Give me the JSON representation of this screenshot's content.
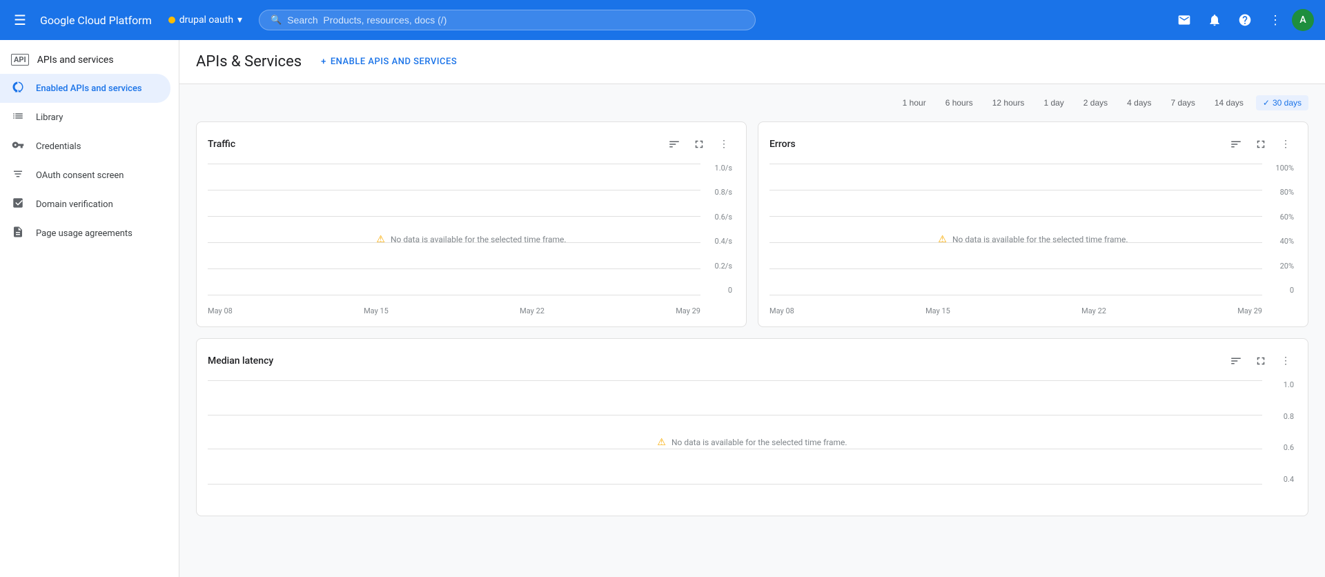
{
  "app": {
    "title": "Google Cloud Platform",
    "api_badge": "API"
  },
  "nav": {
    "menu_icon": "☰",
    "project_name": "drupal oauth",
    "project_dot_color": "#fbbc04",
    "search_placeholder": "Search  Products, resources, docs (/)",
    "search_icon": "🔍",
    "email_icon": "✉",
    "notifications_icon": "🔔",
    "help_icon": "?",
    "more_icon": "⋮",
    "avatar_letter": "A",
    "avatar_bg": "#1e8e3e"
  },
  "sidebar": {
    "header_label": "APIs and services",
    "items": [
      {
        "id": "enabled",
        "label": "Enabled APIs and services",
        "icon": "⚡",
        "active": true
      },
      {
        "id": "library",
        "label": "Library",
        "icon": "☰"
      },
      {
        "id": "credentials",
        "label": "Credentials",
        "icon": "🔑"
      },
      {
        "id": "oauth",
        "label": "OAuth consent screen",
        "icon": "≡"
      },
      {
        "id": "domain",
        "label": "Domain verification",
        "icon": "☑"
      },
      {
        "id": "page-usage",
        "label": "Page usage agreements",
        "icon": "≡"
      }
    ]
  },
  "main": {
    "header_title": "APIs & Services",
    "enable_btn_label": "ENABLE APIS AND SERVICES",
    "enable_btn_plus": "+"
  },
  "time_range": {
    "options": [
      {
        "label": "1 hour",
        "active": false
      },
      {
        "label": "6 hours",
        "active": false
      },
      {
        "label": "12 hours",
        "active": false
      },
      {
        "label": "1 day",
        "active": false
      },
      {
        "label": "2 days",
        "active": false
      },
      {
        "label": "4 days",
        "active": false
      },
      {
        "label": "7 days",
        "active": false
      },
      {
        "label": "14 days",
        "active": false
      },
      {
        "label": "30 days",
        "active": true
      }
    ]
  },
  "traffic_chart": {
    "title": "Traffic",
    "no_data_message": "No data is available for the selected time frame.",
    "y_labels": [
      "1.0/s",
      "0.8/s",
      "0.6/s",
      "0.4/s",
      "0.2/s",
      "0"
    ],
    "x_labels": [
      "May 08",
      "May 15",
      "May 22",
      "May 29"
    ]
  },
  "errors_chart": {
    "title": "Errors",
    "no_data_message": "No data is available for the selected time frame.",
    "y_labels": [
      "100%",
      "80%",
      "60%",
      "40%",
      "20%",
      "0"
    ],
    "x_labels": [
      "May 08",
      "May 15",
      "May 22",
      "May 29"
    ]
  },
  "latency_chart": {
    "title": "Median latency",
    "no_data_message": "No data is available for the selected time frame.",
    "y_labels": [
      "1.0",
      "0.8",
      "0.6",
      "0.4"
    ],
    "x_labels": []
  },
  "icons": {
    "legend": "≡",
    "fullscreen": "⛶",
    "more": "⋮",
    "warning": "⚠"
  }
}
